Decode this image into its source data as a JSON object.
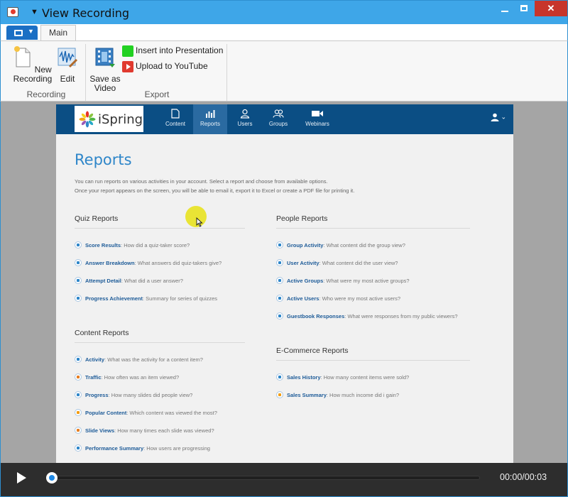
{
  "window": {
    "title": "View Recording"
  },
  "ribbon": {
    "main_tab": "Main",
    "buttons": {
      "new_recording": "New Recording",
      "edit": "Edit",
      "save_as_video": "Save as Video",
      "insert_into_presentation": "Insert into Presentation",
      "upload_to_youtube": "Upload to YouTube"
    },
    "groups": {
      "recording": "Recording",
      "export": "Export"
    }
  },
  "site": {
    "logo": "iSpring",
    "nav": [
      {
        "label": "Content",
        "icon": "document-icon"
      },
      {
        "label": "Reports",
        "icon": "bar-chart-icon",
        "active": true
      },
      {
        "label": "Users",
        "icon": "user-icon"
      },
      {
        "label": "Groups",
        "icon": "group-icon"
      },
      {
        "label": "Webinars",
        "icon": "video-camera-icon"
      }
    ],
    "page_title": "Reports",
    "intro_line1": "You can run reports on various activities in your account. Select a report and choose from available options.",
    "intro_line2": "Once your report appears on the screen, you will be able to email it, export it to Excel or create a PDF file for printing it.",
    "quiz_reports": {
      "title": "Quiz Reports",
      "items": [
        {
          "link": "Score Results",
          "desc": ": How did a quiz-taker score?"
        },
        {
          "link": "Answer Breakdown",
          "desc": ": What answers did quiz-takers give?"
        },
        {
          "link": "Attempt Detail",
          "desc": ": What did a user answer?"
        },
        {
          "link": "Progress Achievement",
          "desc": ": Summary for series of quizzes"
        }
      ]
    },
    "content_reports": {
      "title": "Content Reports",
      "items": [
        {
          "link": "Activity",
          "desc": ": What was the activity for a content item?"
        },
        {
          "link": "Traffic",
          "desc": ": How often was an item viewed?"
        },
        {
          "link": "Progress",
          "desc": ": How many slides did people view?"
        },
        {
          "link": "Popular Content",
          "desc": ": Which content was viewed the most?"
        },
        {
          "link": "Slide Views",
          "desc": ": How many times each slide was viewed?"
        },
        {
          "link": "Performance Summary",
          "desc": ": How users are progressing"
        }
      ]
    },
    "people_reports": {
      "title": "People Reports",
      "items": [
        {
          "link": "Group Activity",
          "desc": ": What content did the group view?"
        },
        {
          "link": "User Activity",
          "desc": ": What content did the user view?"
        },
        {
          "link": "Active Groups",
          "desc": ": What were my most active groups?"
        },
        {
          "link": "Active Users",
          "desc": ": Who were my most active users?"
        },
        {
          "link": "Guestbook Responses",
          "desc": ": What were responses from my public viewers?"
        }
      ]
    },
    "ecommerce_reports": {
      "title": "E-Commerce Reports",
      "items": [
        {
          "link": "Sales History",
          "desc": ": How many content items were sold?"
        },
        {
          "link": "Sales Summary",
          "desc": ": How much income did i gain?"
        }
      ]
    }
  },
  "player": {
    "timecode": "00:00/00:03",
    "progress": 0.0
  },
  "colors": {
    "titlebar": "#3ea6e8",
    "site_header": "#0b4e84",
    "accent": "#2e86c9",
    "close": "#c7352b"
  }
}
